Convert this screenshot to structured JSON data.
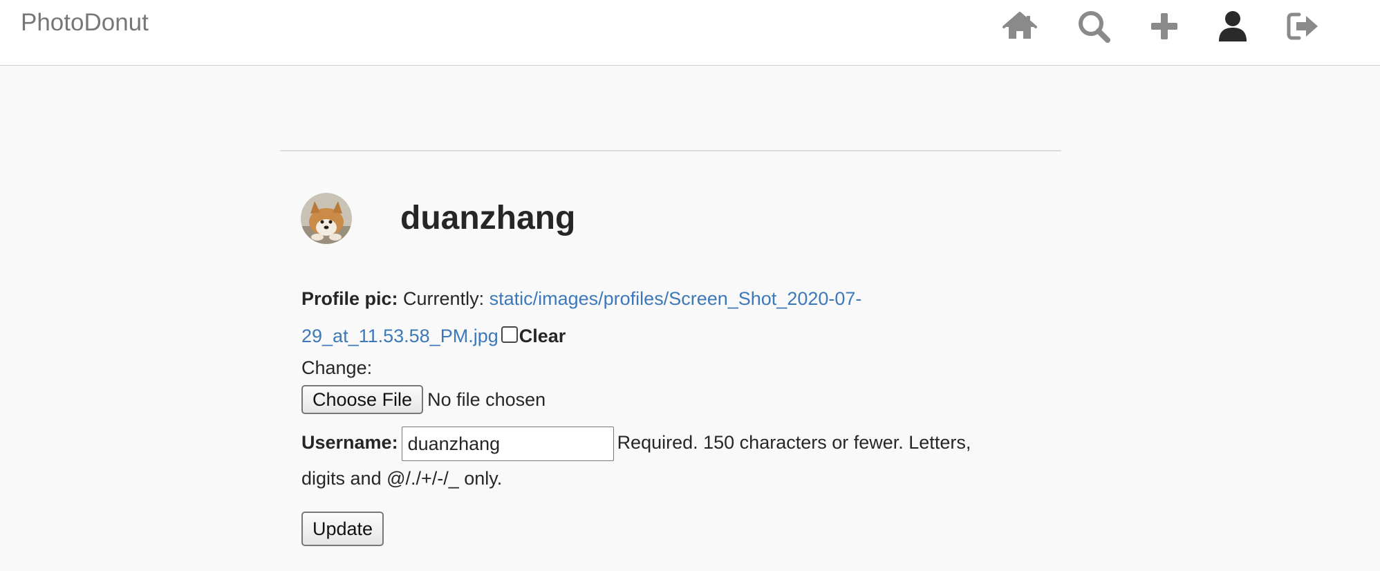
{
  "navbar": {
    "brand": "PhotoDonut",
    "icons": [
      {
        "name": "home-icon",
        "color": "#8a8a8a"
      },
      {
        "name": "search-icon",
        "color": "#8a8a8a"
      },
      {
        "name": "plus-icon",
        "color": "#8a8a8a"
      },
      {
        "name": "user-icon",
        "color": "#2a2a2a"
      },
      {
        "name": "sign-out-icon",
        "color": "#8a8a8a"
      }
    ]
  },
  "profile": {
    "username": "duanzhang"
  },
  "form": {
    "profile_pic_label": "Profile pic:",
    "currently_label": "Currently:",
    "current_file_link_line1": "static/images/profiles/Screen_Shot_2020-07-",
    "current_file_link_line2": "29_at_11.53.58_PM.jpg",
    "clear_label": "Clear",
    "change_label": "Change:",
    "choose_file_button": "Choose File",
    "file_status": "No file chosen",
    "username_label": "Username:",
    "username_value": "duanzhang",
    "username_help_line1": "Required. 150 characters or fewer. Letters,",
    "username_help_line2": "digits and @/./+/-/_ only.",
    "update_button": "Update"
  },
  "colors": {
    "link": "#3d78b8",
    "background": "#f9f9f9",
    "navbar_bg": "#ffffff"
  }
}
